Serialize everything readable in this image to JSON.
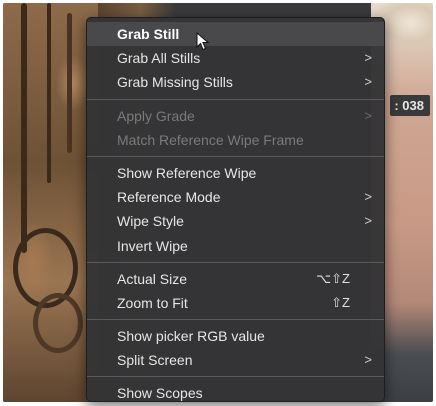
{
  "timecode_badge": ": 038",
  "menu": {
    "groups": [
      [
        {
          "label": "Grab Still",
          "state": "highlighted"
        },
        {
          "label": "Grab All Stills",
          "submenu": true
        },
        {
          "label": "Grab Missing Stills",
          "submenu": true
        }
      ],
      [
        {
          "label": "Apply Grade",
          "state": "disabled",
          "submenu": true
        },
        {
          "label": "Match Reference Wipe Frame",
          "state": "disabled"
        }
      ],
      [
        {
          "label": "Show Reference Wipe"
        },
        {
          "label": "Reference Mode",
          "submenu": true
        },
        {
          "label": "Wipe Style",
          "submenu": true
        },
        {
          "label": "Invert Wipe"
        }
      ],
      [
        {
          "label": "Actual Size",
          "shortcut": "⌥⇧Z"
        },
        {
          "label": "Zoom to Fit",
          "shortcut": "⇧Z"
        }
      ],
      [
        {
          "label": "Show picker RGB value"
        },
        {
          "label": "Split Screen",
          "submenu": true
        }
      ],
      [
        {
          "label": "Show Scopes"
        }
      ]
    ],
    "submenu_glyph": ">"
  },
  "icons": {
    "cursor": "mouse-pointer-icon",
    "submenu": "chevron-right-icon"
  },
  "colors": {
    "menu_bg": "#343436",
    "highlight": "#49494c",
    "disabled_text": "#7a7a7c"
  }
}
